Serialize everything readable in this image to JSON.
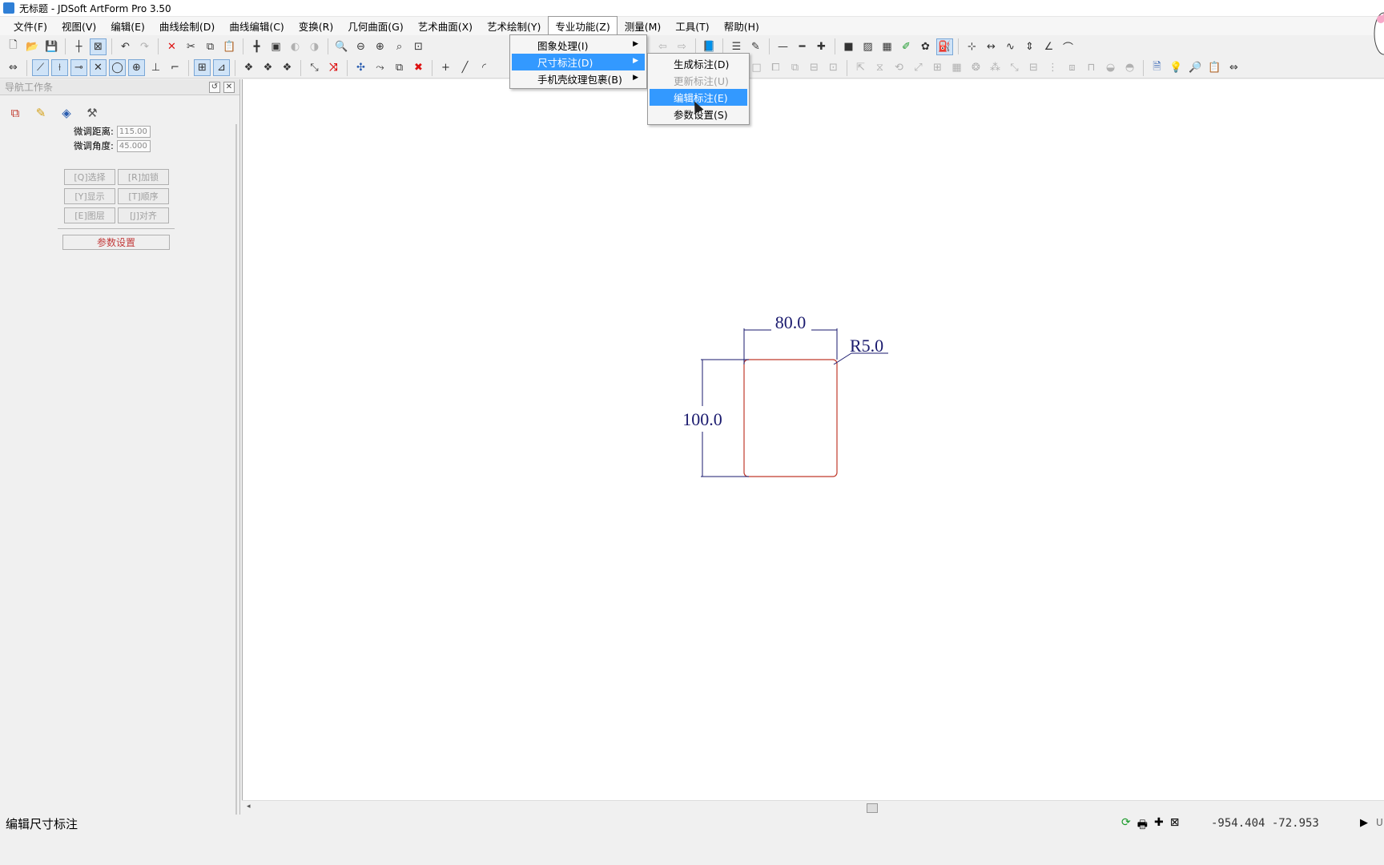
{
  "window": {
    "title": "无标题 - JDSoft ArtForm Pro 3.50"
  },
  "menubar": {
    "items": [
      "文件(F)",
      "视图(V)",
      "编辑(E)",
      "曲线绘制(D)",
      "曲线编辑(C)",
      "变换(R)",
      "几何曲面(G)",
      "艺术曲面(X)",
      "艺术绘制(Y)",
      "专业功能(Z)",
      "测量(M)",
      "工具(T)",
      "帮助(H)"
    ],
    "open": "专业功能(Z)"
  },
  "pro_menu": {
    "items": [
      {
        "label": "图象处理(I)",
        "has_submenu": true
      },
      {
        "label": "尺寸标注(D)",
        "has_submenu": true,
        "highlighted": true
      },
      {
        "label": "手机壳纹理包裹(B)",
        "has_submenu": true
      }
    ]
  },
  "dimension_submenu": {
    "items": [
      {
        "label": "生成标注(D)",
        "enabled": true
      },
      {
        "label": "更新标注(U)",
        "enabled": false
      },
      {
        "label": "编辑标注(E)",
        "enabled": true,
        "highlighted": true
      },
      {
        "label": "参数设置(S)",
        "enabled": true
      }
    ]
  },
  "nav_panel": {
    "title": "导航工作条",
    "tabs": [
      "select-tab-icon",
      "edit-tab-icon",
      "surface-tab-icon",
      "tools-tab-icon"
    ],
    "fine_distance_label": "微调距离:",
    "fine_distance_value": "115.00",
    "fine_angle_label": "微调角度:",
    "fine_angle_value": "45.000",
    "buttons": [
      "[Q]选择",
      "[R]加锁",
      "[Y]显示",
      "[T]顺序",
      "[E]图层",
      "[J]对齐"
    ],
    "param_button": "参数设置"
  },
  "drawing": {
    "width_dim": "80.0",
    "height_dim": "100.0",
    "radius_dim": "R5.0",
    "shape_color": "#c0392b",
    "dim_color": "#1a1a6e"
  },
  "status": {
    "text": "编辑尺寸标注",
    "coords": "-954.404  -72.953",
    "unit_label": "U"
  }
}
